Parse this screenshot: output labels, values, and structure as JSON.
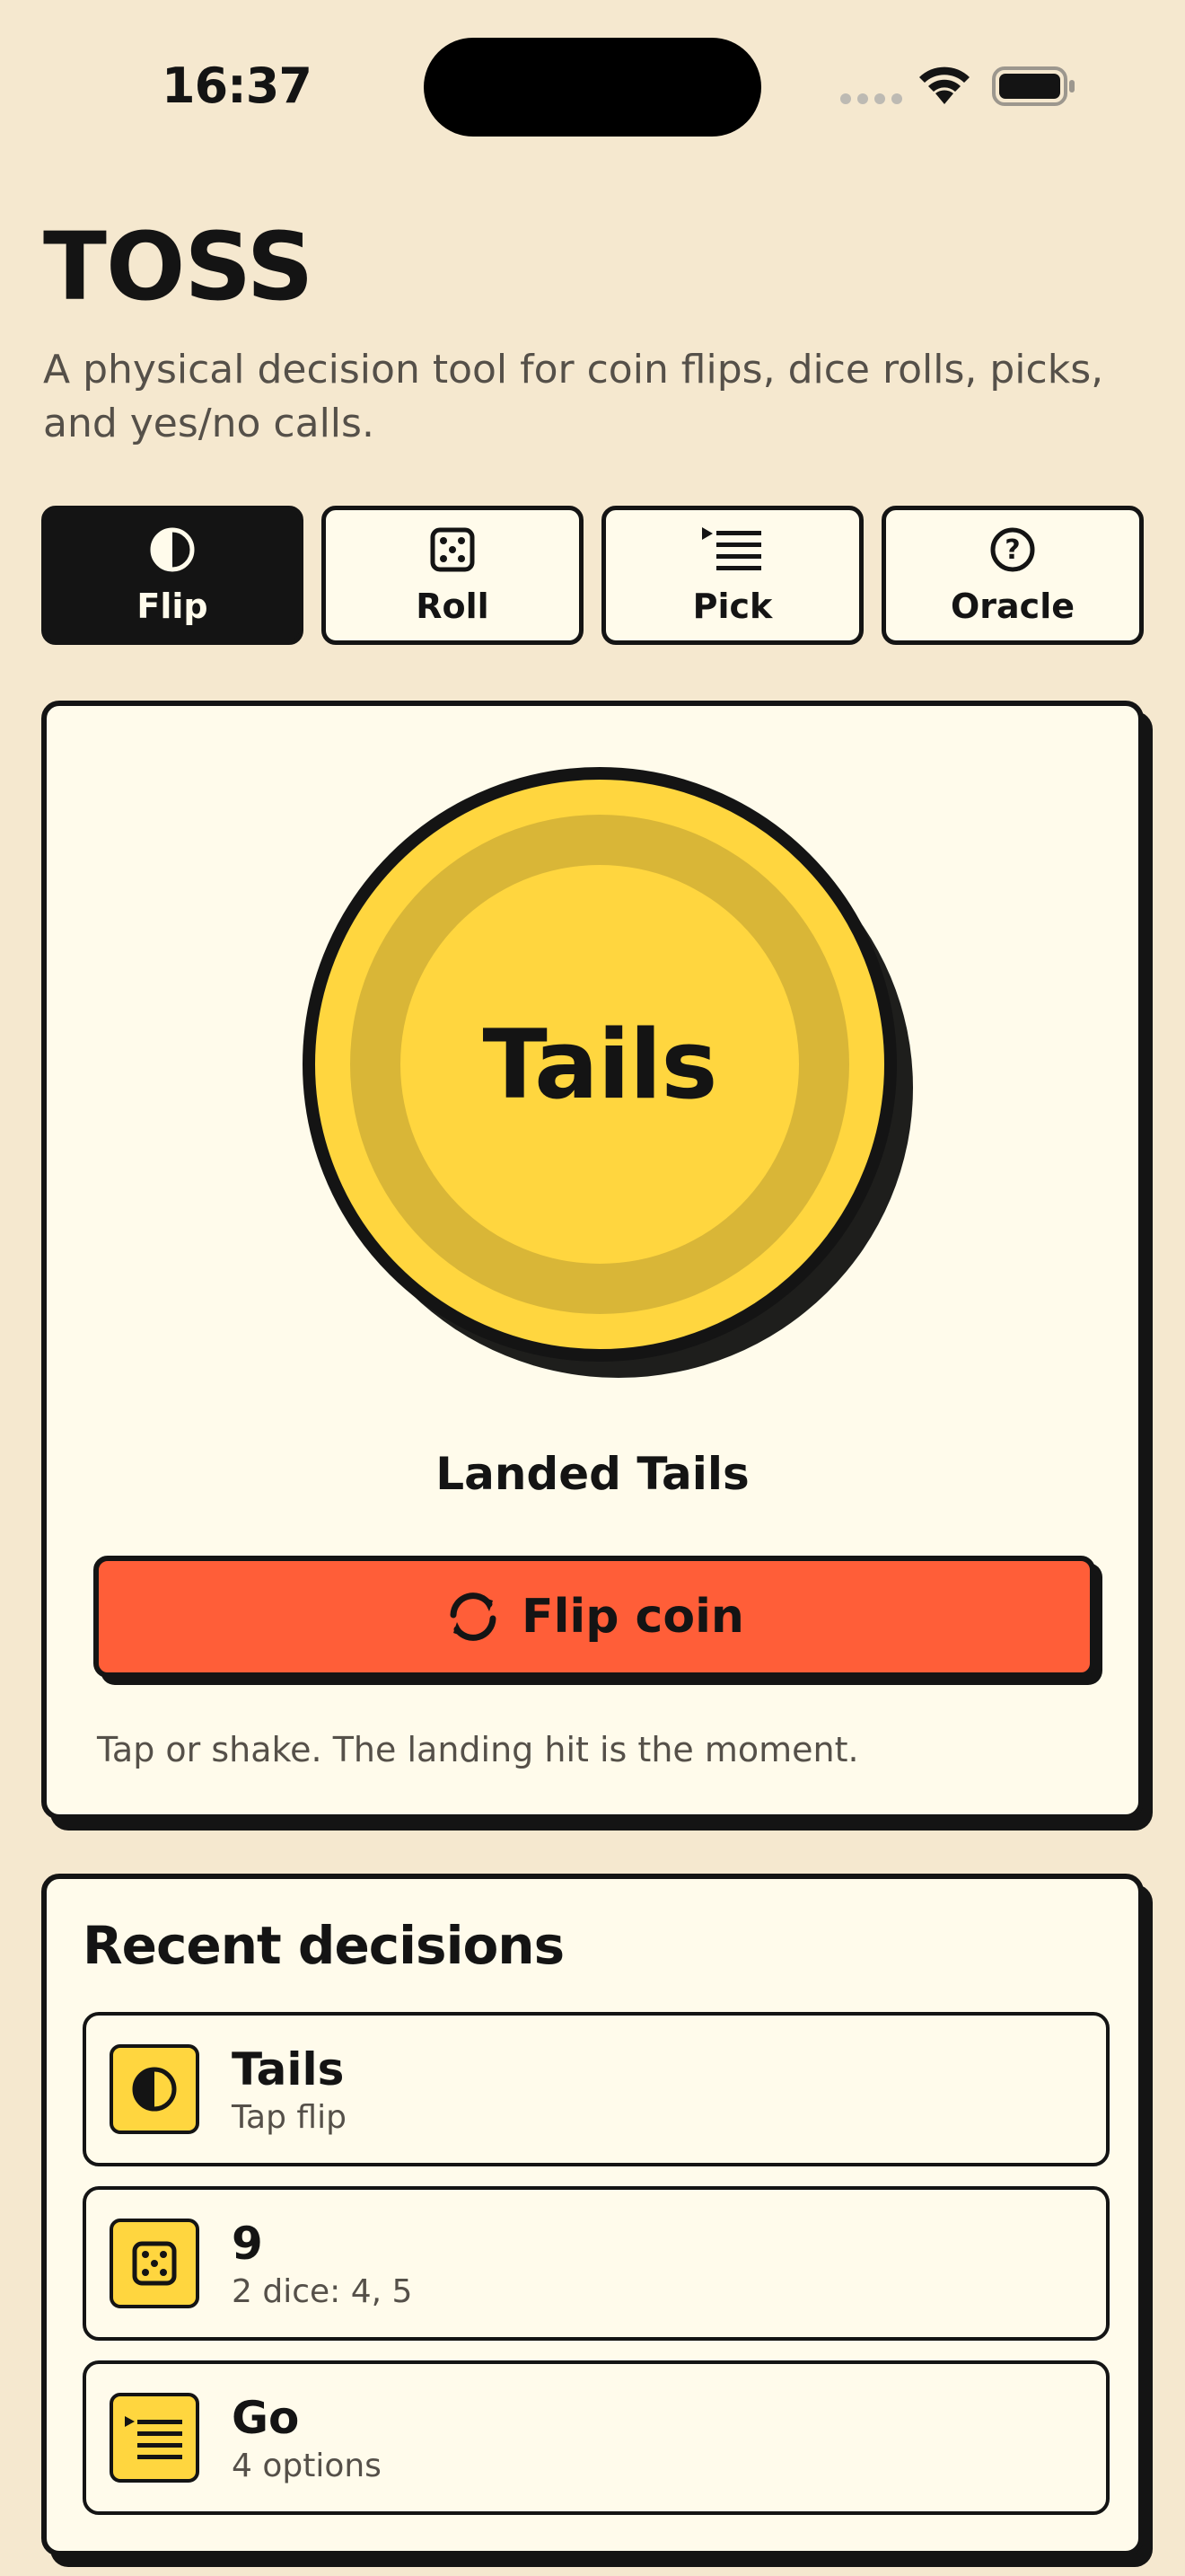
{
  "status_bar": {
    "time": "16:37"
  },
  "header": {
    "title": "TOSS",
    "subtitle": "A physical decision tool for coin flips, dice rolls, picks, and yes/no calls."
  },
  "tabs": [
    {
      "label": "Flip",
      "icon": "half-circle-icon",
      "active": true
    },
    {
      "label": "Roll",
      "icon": "dice-icon",
      "active": false
    },
    {
      "label": "Pick",
      "icon": "list-icon",
      "active": false
    },
    {
      "label": "Oracle",
      "icon": "question-circle-icon",
      "active": false
    }
  ],
  "coin": {
    "face": "Tails",
    "result": "Landed Tails",
    "button_label": "Flip coin",
    "hint": "Tap or shake. The landing hit is the moment."
  },
  "recent": {
    "title": "Recent decisions",
    "items": [
      {
        "title": "Tails",
        "subtitle": "Tap flip",
        "icon": "half-circle-icon"
      },
      {
        "title": "9",
        "subtitle": "2 dice: 4, 5",
        "icon": "dice-icon"
      },
      {
        "title": "Go",
        "subtitle": "4 options",
        "icon": "list-icon"
      }
    ]
  },
  "colors": {
    "background": "#F5E8CF",
    "card": "#FFFBEB",
    "ink": "#141414",
    "coin_yellow": "#FFD63F",
    "accent_orange": "#FF5E38"
  }
}
